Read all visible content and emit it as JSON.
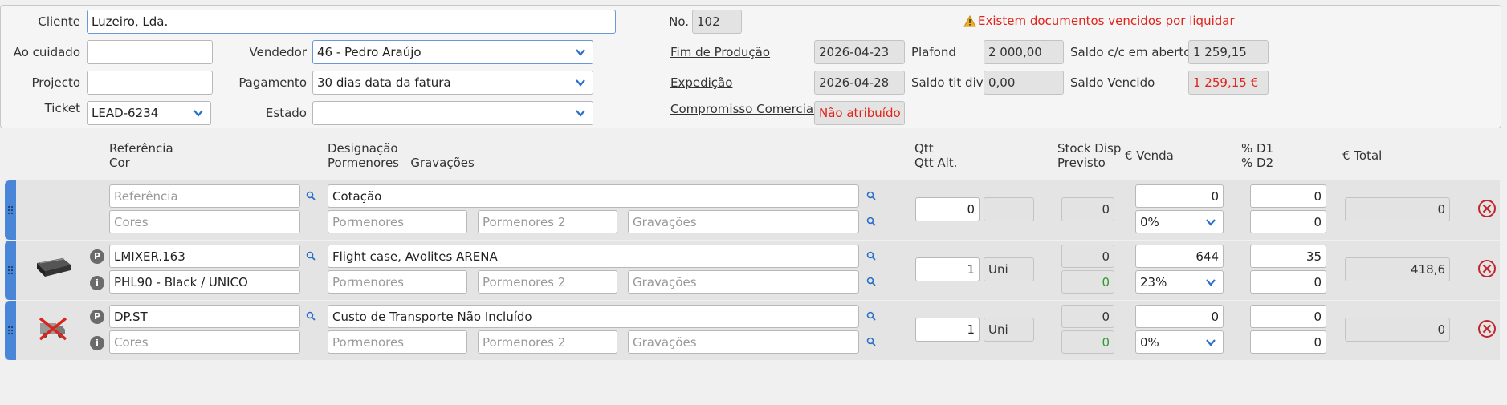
{
  "header": {
    "cliente_label": "Cliente",
    "cliente_value": "Luzeiro, Lda.",
    "ao_cuidado_label": "Ao cuidado",
    "ao_cuidado_value": "",
    "projecto_label": "Projecto",
    "projecto_value": "",
    "ticket_label": "Ticket",
    "ticket_value": "LEAD-6234",
    "vendedor_label": "Vendedor",
    "vendedor_value": "46 - Pedro Araújo",
    "pagamento_label": "Pagamento",
    "pagamento_value": "30 dias data da fatura",
    "estado_label": "Estado",
    "estado_value": "",
    "no_label": "No.",
    "no_value": "102",
    "warning_text": "Existem documentos vencidos por liquidar",
    "fim_producao_label": "Fim de Produção",
    "fim_producao_value": "2026-04-23",
    "expedicao_label": "Expedição",
    "expedicao_value": "2026-04-28",
    "compromisso_label": "Compromisso Comercial",
    "compromisso_value": "Não atribuído",
    "plafond_label": "Plafond",
    "plafond_value": "2 000,00",
    "saldo_tit_div_label": "Saldo tit div",
    "saldo_tit_div_value": "0,00",
    "saldo_cc_label": "Saldo c/c em aberto",
    "saldo_cc_value": "1 259,15",
    "saldo_vencido_label": "Saldo Vencido",
    "saldo_vencido_value": "1 259,15 €"
  },
  "columns": {
    "referencia": "Referência",
    "cor": "Cor",
    "designacao": "Designação",
    "pormenores": "Pormenores",
    "gravacoes": "Gravações",
    "qtt": "Qtt",
    "qtt_alt": "Qtt Alt.",
    "stock_disp": "Stock Disp",
    "previsto": "Previsto",
    "venda": "€ Venda",
    "d1": "% D1",
    "d2": "% D2",
    "total": "€ Total"
  },
  "placeholders": {
    "referencia": "Referência",
    "cores": "Cores",
    "pormenores": "Pormenores",
    "pormenores2": "Pormenores 2",
    "gravacoes": "Gravações"
  },
  "lines": [
    {
      "referencia": "",
      "cor": "",
      "designacao": "Cotação",
      "qtt": "0",
      "unit": "",
      "stock": "0",
      "previsto": "",
      "venda": "0",
      "iva": "0%",
      "d1": "0",
      "d2": "0",
      "total": "0",
      "image": "none",
      "p_badge": "",
      "info_icon": false
    },
    {
      "referencia": "LMIXER.163",
      "cor": "PHL90 - Black / UNICO",
      "designacao": "Flight case, Avolites ARENA",
      "qtt": "1",
      "unit": "Uni",
      "stock": "0",
      "previsto": "0",
      "venda": "644",
      "iva": "23%",
      "d1": "35",
      "d2": "0",
      "total": "418,6",
      "image": "flight-case-icon",
      "p_badge": "P",
      "info_icon": true
    },
    {
      "referencia": "DP.ST",
      "cor": "",
      "designacao": "Custo de Transporte Não Incluído",
      "qtt": "1",
      "unit": "Uni",
      "stock": "0",
      "previsto": "0",
      "venda": "0",
      "iva": "0%",
      "d1": "0",
      "d2": "0",
      "total": "0",
      "image": "no-transport-icon",
      "p_badge": "P",
      "info_icon": true
    }
  ],
  "colors": {
    "accent_blue": "#4a86d8",
    "warning_red": "#e2231a",
    "stock_green": "#2f9a2f"
  }
}
